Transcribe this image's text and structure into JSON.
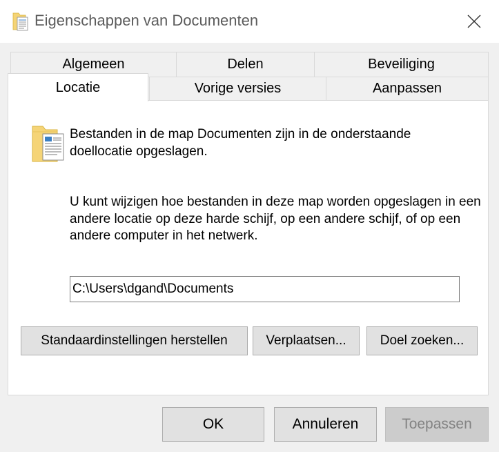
{
  "window": {
    "title": "Eigenschappen van Documenten",
    "close_glyph": "✕"
  },
  "tabs": {
    "row1": [
      "Algemeen",
      "Delen",
      "Beveiliging"
    ],
    "row2": [
      "Locatie",
      "Vorige versies",
      "Aanpassen"
    ],
    "active": "Locatie"
  },
  "location": {
    "description": "Bestanden in de map Documenten zijn in de onderstaande doellocatie opgeslagen.",
    "info": "U kunt wijzigen hoe bestanden in deze map worden opgeslagen in een andere locatie op deze harde schijf, op een andere schijf, of op een andere computer in het netwerk.",
    "path_value": "C:\\Users\\dgand\\Documents",
    "buttons": {
      "restore_default": "Standaardinstellingen herstellen",
      "move": "Verplaatsen...",
      "find_target": "Doel zoeken..."
    }
  },
  "footer": {
    "ok": "OK",
    "cancel": "Annuleren",
    "apply": "Toepassen"
  },
  "colors": {
    "accent_folder": "#f5d477",
    "disabled_text": "#838383"
  }
}
